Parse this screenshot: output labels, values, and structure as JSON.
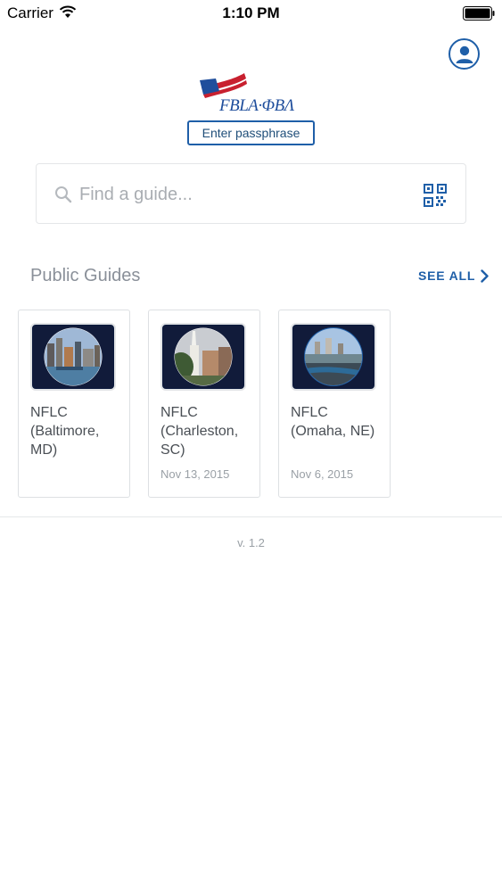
{
  "status_bar": {
    "carrier": "Carrier",
    "time": "1:10 PM"
  },
  "header": {
    "logo_text": "FBLA·ΦBΛ",
    "passphrase_label": "Enter passphrase"
  },
  "search": {
    "placeholder": "Find a guide..."
  },
  "section": {
    "title": "Public Guides",
    "see_all": "SEE ALL"
  },
  "guides": [
    {
      "title": "NFLC (Baltimore, MD)",
      "date": ""
    },
    {
      "title": "NFLC (Charleston, SC)",
      "date": "Nov 13, 2015"
    },
    {
      "title": "NFLC (Omaha, NE)",
      "date": "Nov 6, 2015"
    }
  ],
  "footer": {
    "version": "v. 1.2"
  },
  "colors": {
    "accent": "#1f5fa8",
    "muted": "#8a9099",
    "flag_red": "#c8202f"
  },
  "icons": [
    "wifi-icon",
    "battery-icon",
    "user-icon",
    "search-icon",
    "qr-code-icon",
    "chevron-right-icon"
  ]
}
